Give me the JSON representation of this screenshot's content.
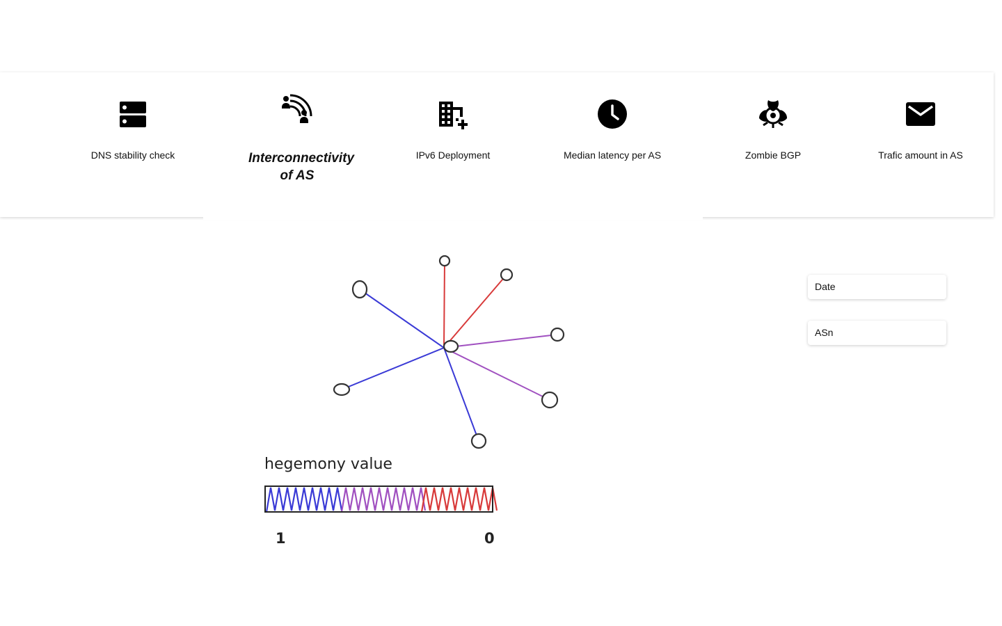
{
  "nav": {
    "items": [
      {
        "label": "DNS stability check",
        "icon": "server-icon"
      },
      {
        "label": "Interconnectivity of AS",
        "icon": "network-nodes-icon",
        "active": true
      },
      {
        "label": "IPv6 Deployment",
        "icon": "building-add-icon"
      },
      {
        "label": "Median latency per AS",
        "icon": "clock-icon"
      },
      {
        "label": "Zombie  BGP",
        "icon": "biohazard-icon"
      },
      {
        "label": "Trafic amount in AS",
        "icon": "mail-icon"
      }
    ]
  },
  "filters": {
    "date_label": "Date",
    "asn_label": "ASn"
  },
  "graph": {
    "edges": [
      {
        "hegemony": 0.0
      },
      {
        "hegemony": 0.0
      },
      {
        "hegemony": 0.45
      },
      {
        "hegemony": 0.45
      },
      {
        "hegemony": 1.0
      },
      {
        "hegemony": 1.0
      },
      {
        "hegemony": 1.0
      }
    ],
    "legend": {
      "title": "hegemony value",
      "min_label": "1",
      "max_label": "0"
    }
  },
  "colors": {
    "hegemony_high": "#3a3ad6",
    "hegemony_mid": "#a050c0",
    "hegemony_low": "#d83a3a",
    "node_stroke": "#333333"
  }
}
